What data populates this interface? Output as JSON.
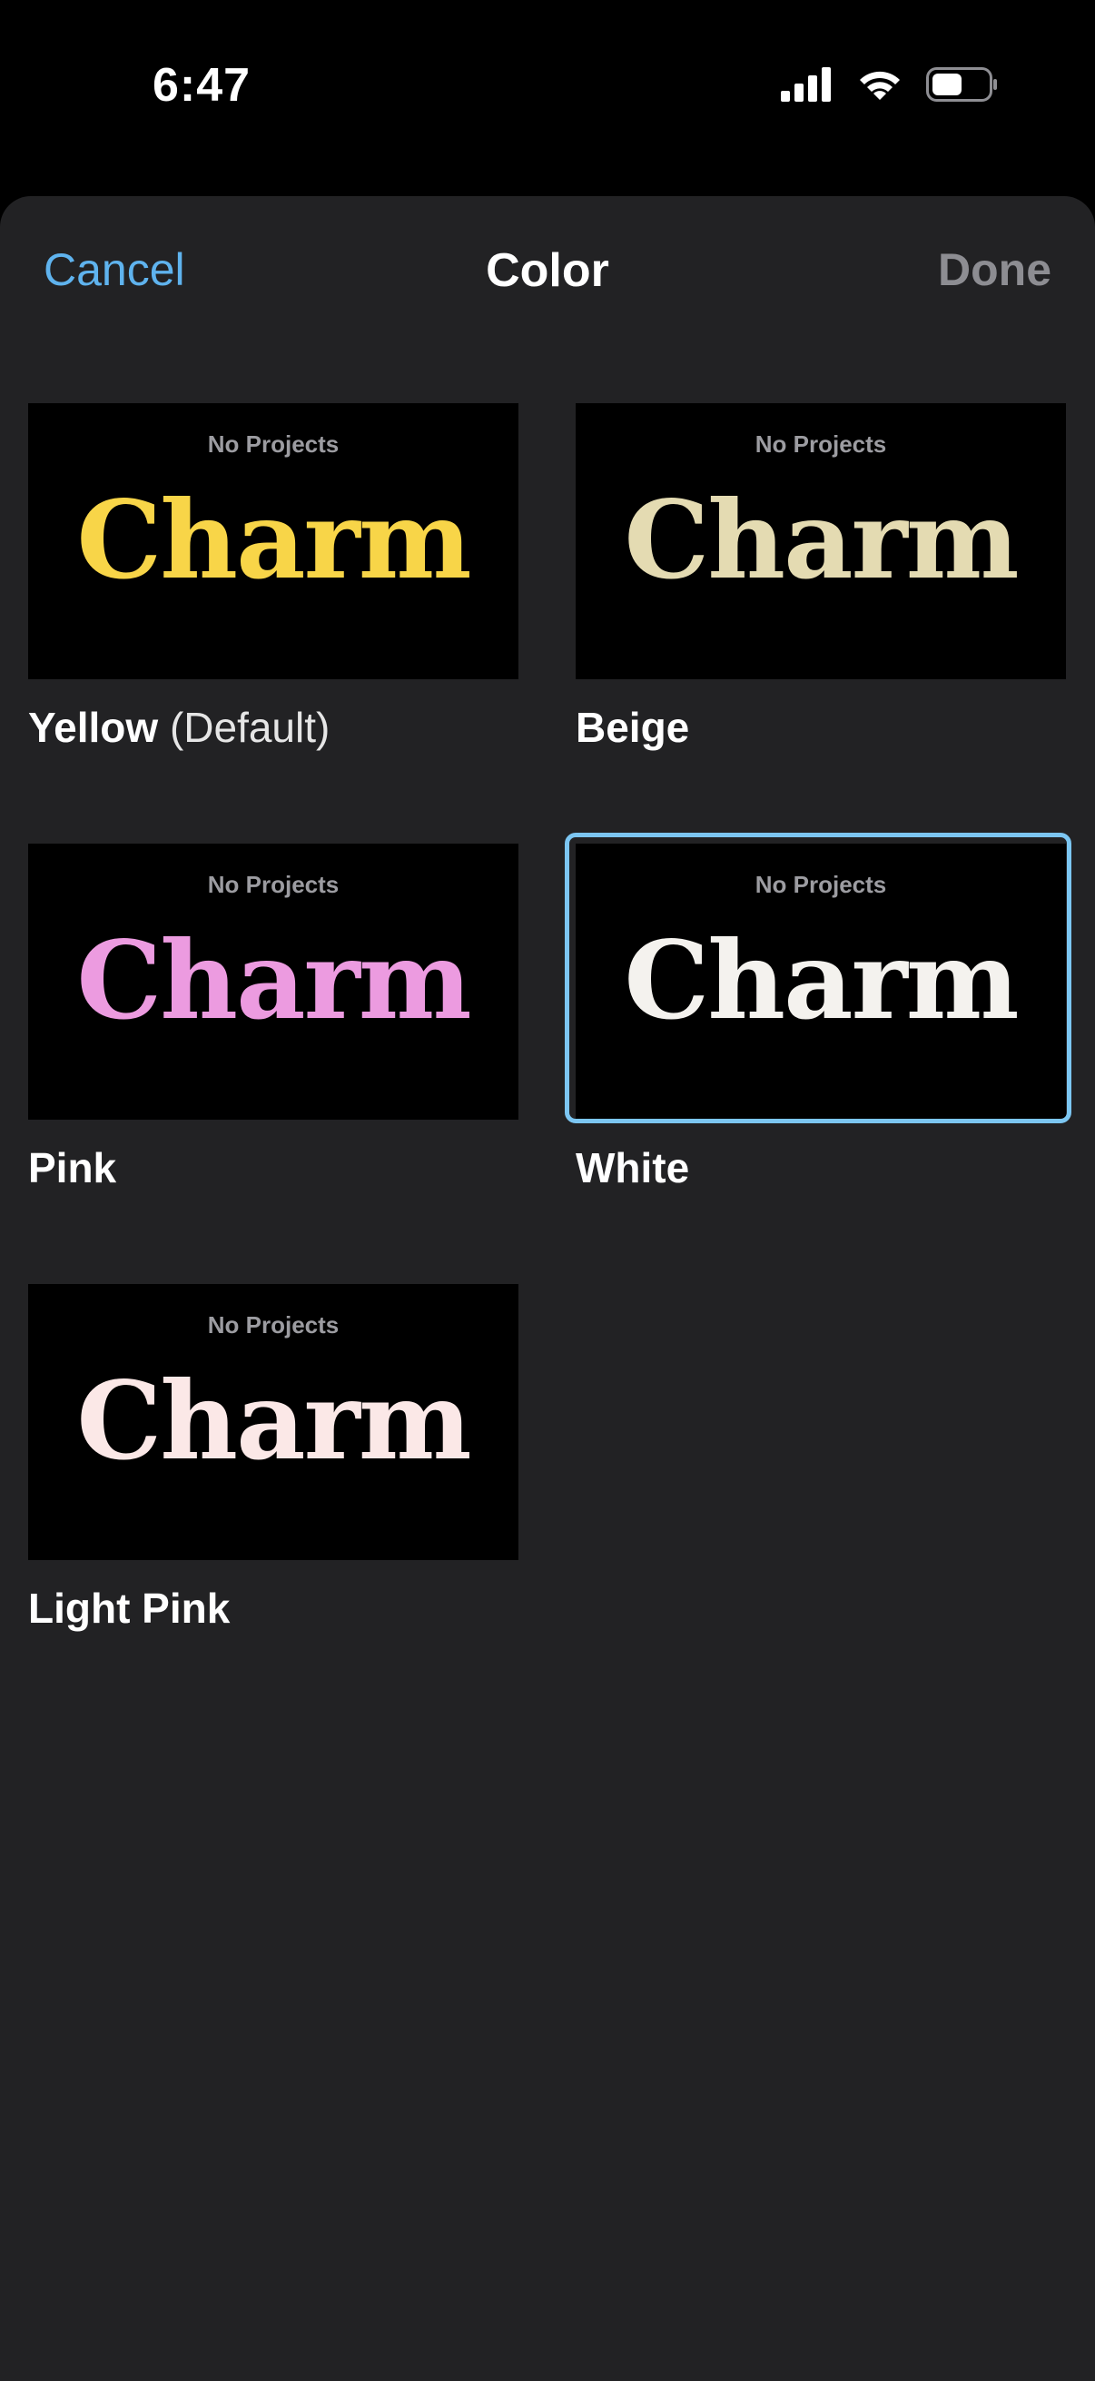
{
  "status_bar": {
    "time": "6:47",
    "icons": [
      "cellular-signal-icon",
      "wifi-icon",
      "battery-icon"
    ]
  },
  "nav": {
    "cancel_label": "Cancel",
    "title": "Color",
    "done_label": "Done"
  },
  "colors": {
    "accent": "#5fb3ee",
    "selection_ring": "#7cc6f2",
    "sheet_background": "#222224"
  },
  "options": [
    {
      "name": "Yellow",
      "suffix": " (Default)",
      "preview_subtitle": "No Projects",
      "preview_word": "Charm",
      "word_color": "#f8d548",
      "selected": false
    },
    {
      "name": "Beige",
      "suffix": "",
      "preview_subtitle": "No Projects",
      "preview_word": "Charm",
      "word_color": "#e4dbb2",
      "selected": false
    },
    {
      "name": "Pink",
      "suffix": "",
      "preview_subtitle": "No Projects",
      "preview_word": "Charm",
      "word_color": "#ec9be0",
      "selected": false
    },
    {
      "name": "White",
      "suffix": "",
      "preview_subtitle": "No Projects",
      "preview_word": "Charm",
      "word_color": "#f4f2ee",
      "selected": true
    },
    {
      "name": "Light Pink",
      "suffix": "",
      "preview_subtitle": "No Projects",
      "preview_word": "Charm",
      "word_color": "#fbe8e7",
      "selected": false
    }
  ]
}
